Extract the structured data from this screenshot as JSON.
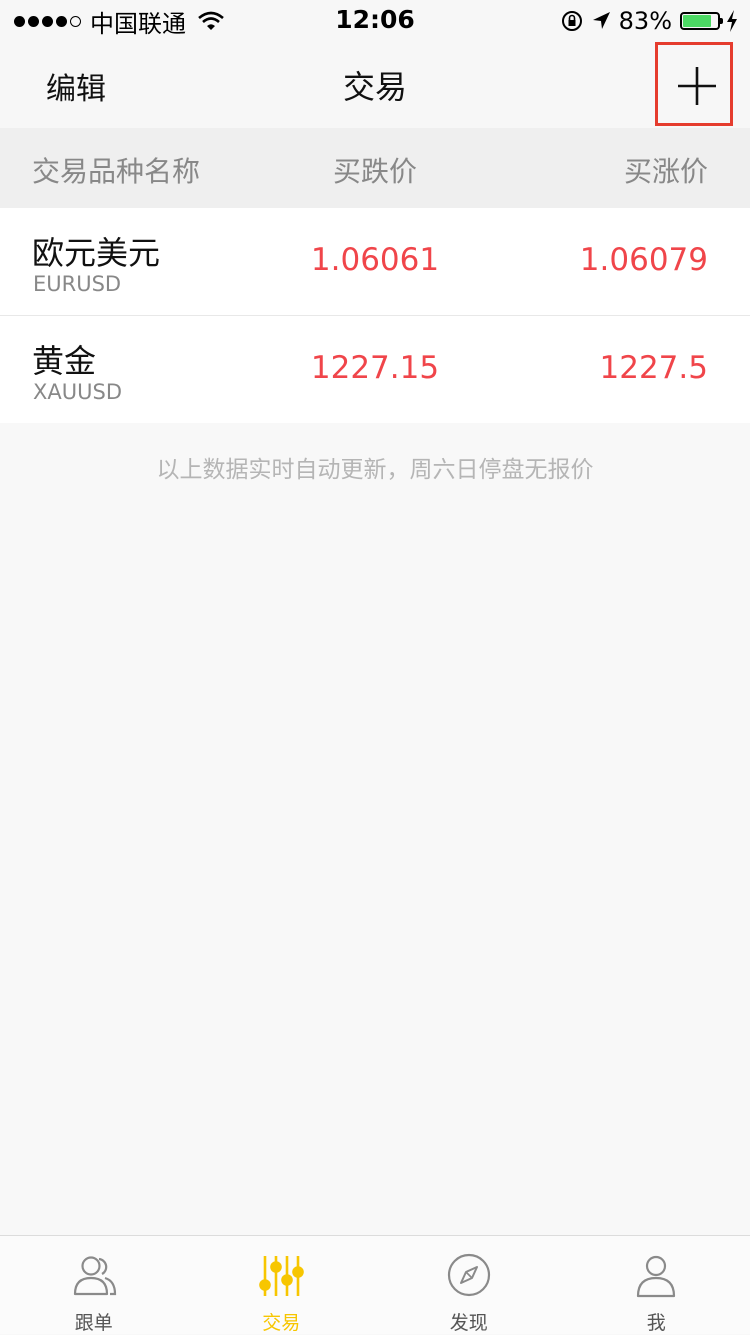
{
  "status_bar": {
    "carrier": "中国联通",
    "time": "12:06",
    "battery_percent_label": "83%",
    "battery_level": 0.83,
    "battery_color": "#4cd964",
    "icons": [
      "signal-dots",
      "wifi-icon",
      "orientation-lock-icon",
      "location-arrow-icon",
      "battery-icon",
      "charging-bolt-icon"
    ]
  },
  "nav": {
    "edit_label": "编辑",
    "title": "交易",
    "add_icon": "plus-icon",
    "highlight_color": "#e53c2e"
  },
  "table": {
    "headers": {
      "name": "交易品种名称",
      "bid": "买跌价",
      "ask": "买涨价"
    },
    "rows": [
      {
        "name_cn": "欧元美元",
        "code": "EURUSD",
        "bid": "1.06061",
        "ask": "1.06079"
      },
      {
        "name_cn": "黄金",
        "code": "XAUUSD",
        "bid": "1227.15",
        "ask": "1227.5"
      }
    ],
    "price_color": "#f0454a"
  },
  "footnote": "以上数据实时自动更新，周六日停盘无报价",
  "tabs": [
    {
      "label": "跟单",
      "icon": "users-icon",
      "active": false
    },
    {
      "label": "交易",
      "icon": "sliders-icon",
      "active": true
    },
    {
      "label": "发现",
      "icon": "compass-icon",
      "active": false
    },
    {
      "label": "我",
      "icon": "person-icon",
      "active": false
    }
  ],
  "active_tab_color": "#f7c600"
}
